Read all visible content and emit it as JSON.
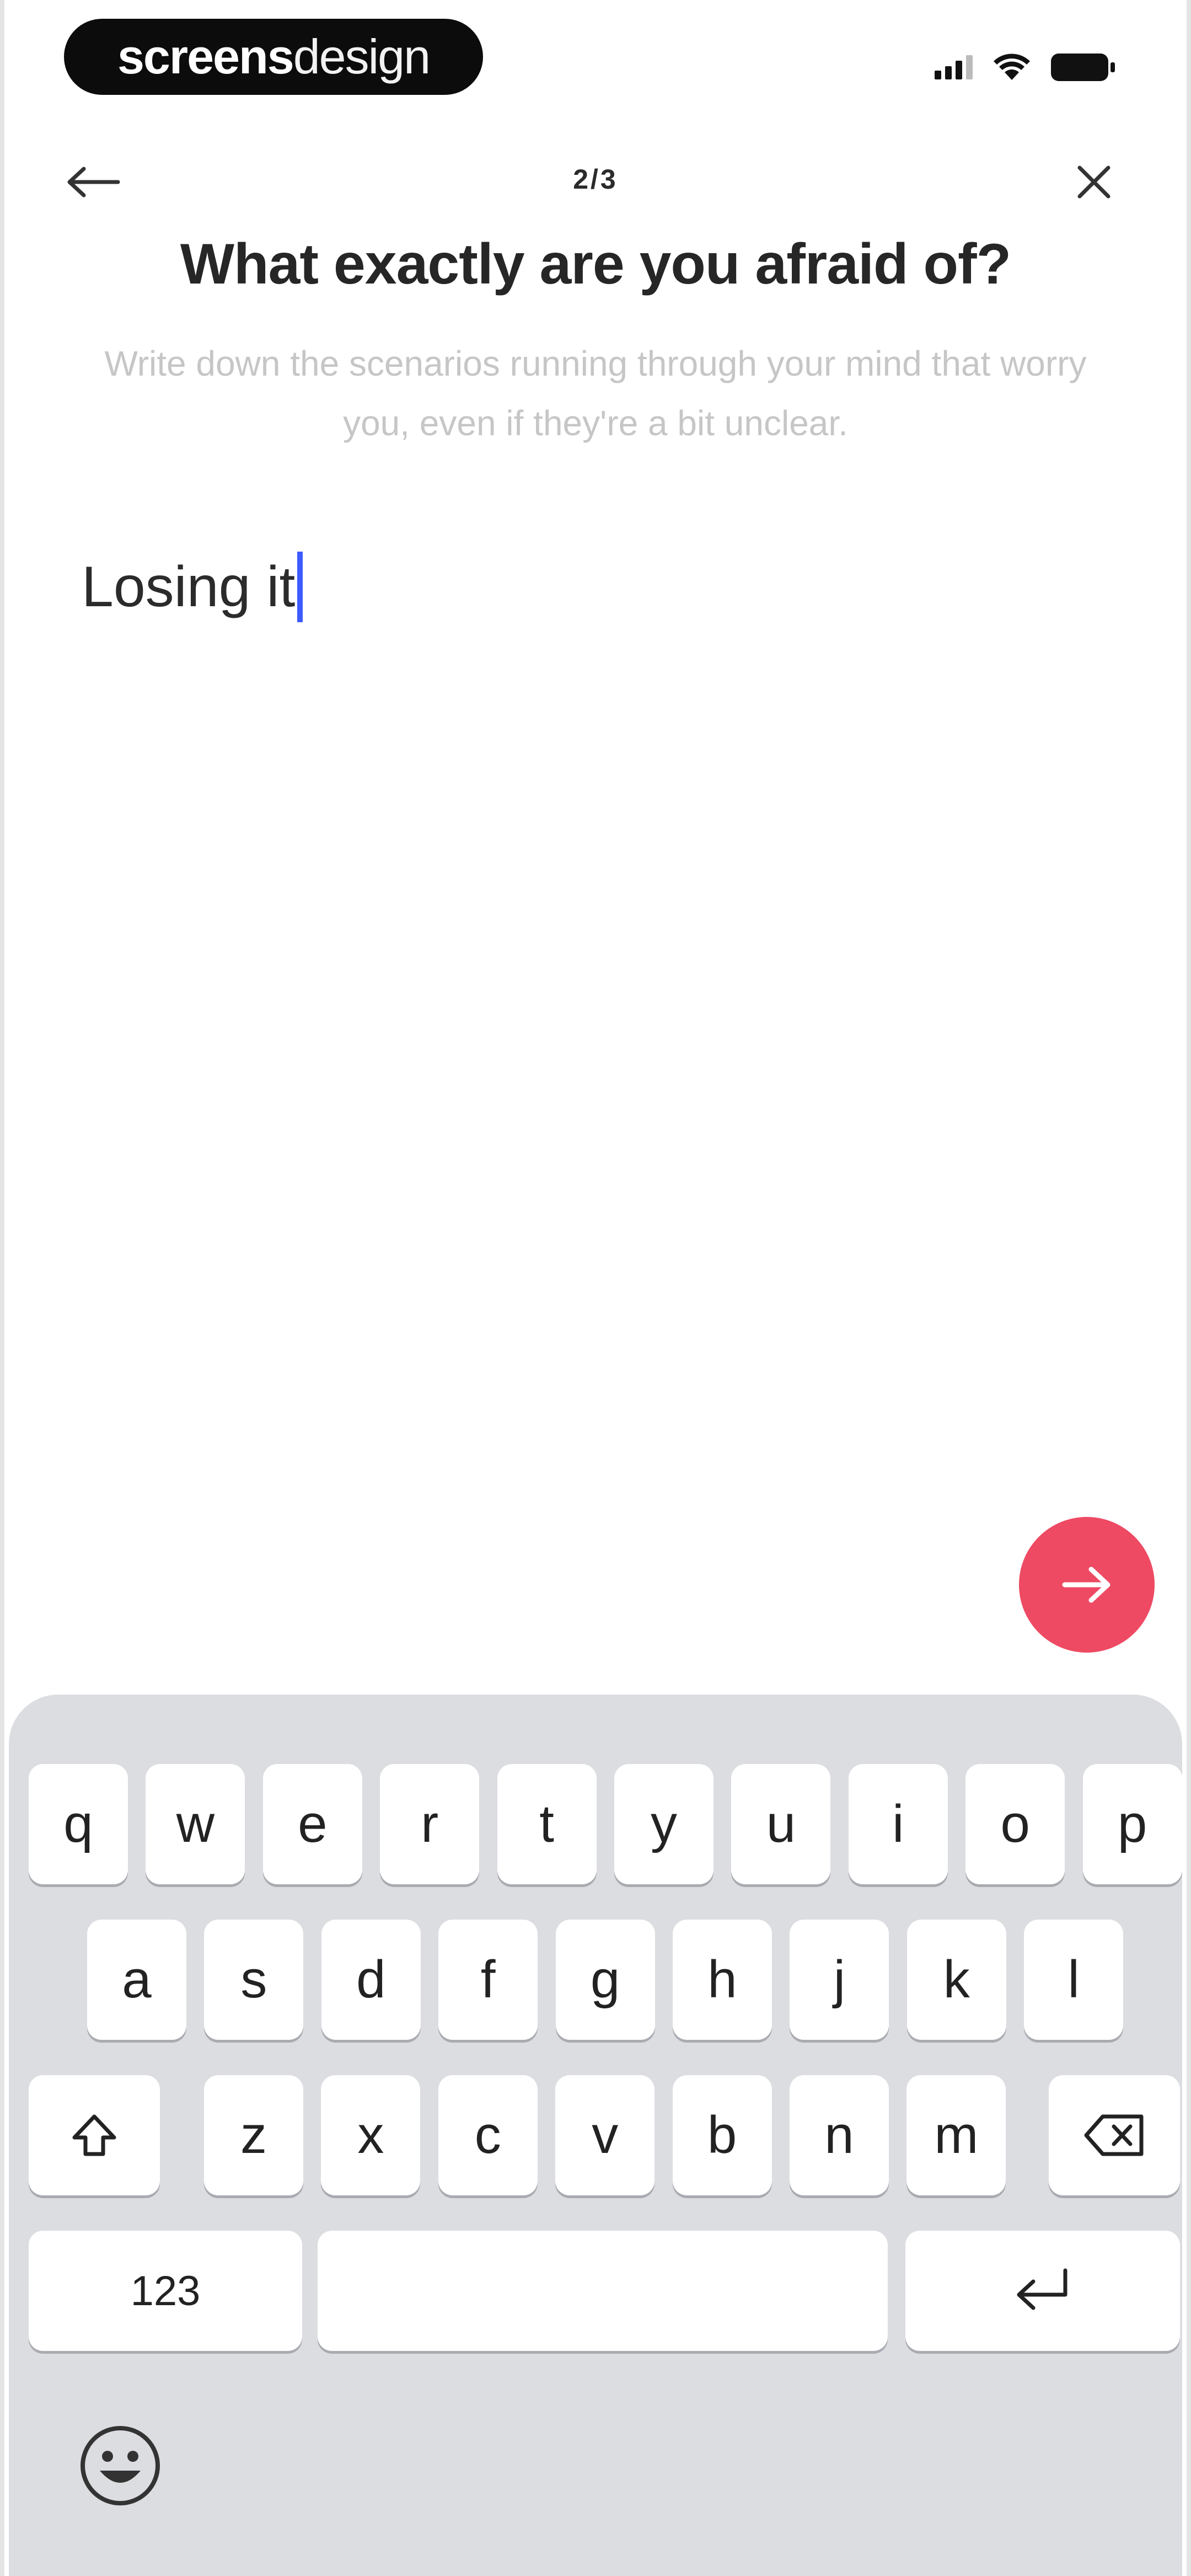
{
  "status_bar": {
    "brand_part1": "screens",
    "brand_part2": "design"
  },
  "header": {
    "step": "2/3",
    "title": "What exactly are you afraid of?",
    "subtitle": "Write down the scenarios running through your mind that worry you, even if they're a bit unclear."
  },
  "answer": {
    "value": "Losing it"
  },
  "next_button": {
    "icon": "arrow-right-icon",
    "color": "#ee4a63"
  },
  "keyboard": {
    "row1": [
      "q",
      "w",
      "e",
      "r",
      "t",
      "y",
      "u",
      "i",
      "o",
      "p"
    ],
    "row2": [
      "a",
      "s",
      "d",
      "f",
      "g",
      "h",
      "j",
      "k",
      "l"
    ],
    "row3": [
      "z",
      "x",
      "c",
      "v",
      "b",
      "n",
      "m"
    ],
    "numbers_label": "123",
    "shift_icon": "shift-icon",
    "backspace_icon": "backspace-icon",
    "return_icon": "return-icon",
    "emoji_icon": "emoji-icon"
  }
}
